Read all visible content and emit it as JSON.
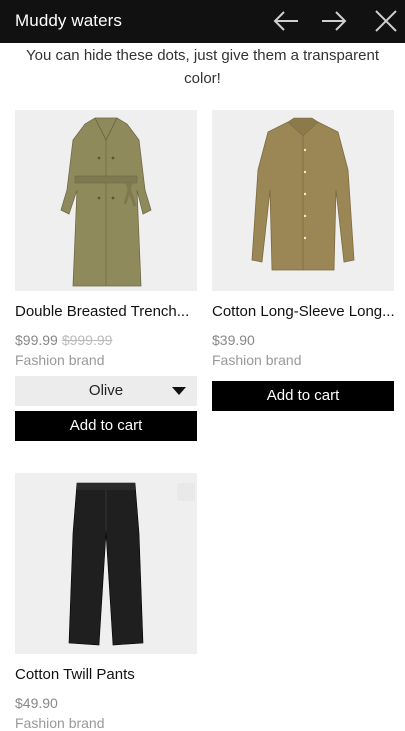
{
  "header": {
    "title": "Muddy waters"
  },
  "notice": "You can hide these dots, just give them a transparent color!",
  "products": [
    {
      "name": "Double Breasted Trench...",
      "price": "$99.99",
      "old_price": "$999.99",
      "brand": "Fashion brand",
      "variant": "Olive",
      "button": "Add to cart"
    },
    {
      "name": "Cotton Long-Sleeve Long...",
      "price": "$39.90",
      "brand": "Fashion brand",
      "button": "Add to cart"
    },
    {
      "name": "Cotton Twill Pants",
      "price": "$49.90",
      "brand": "Fashion brand"
    }
  ],
  "colors": {
    "header_bg": "#111111",
    "button_bg": "#000000",
    "image_bg": "#efefef",
    "coat": "#8f8a5c",
    "shirt": "#9b8755",
    "pants": "#1f1f1f"
  }
}
